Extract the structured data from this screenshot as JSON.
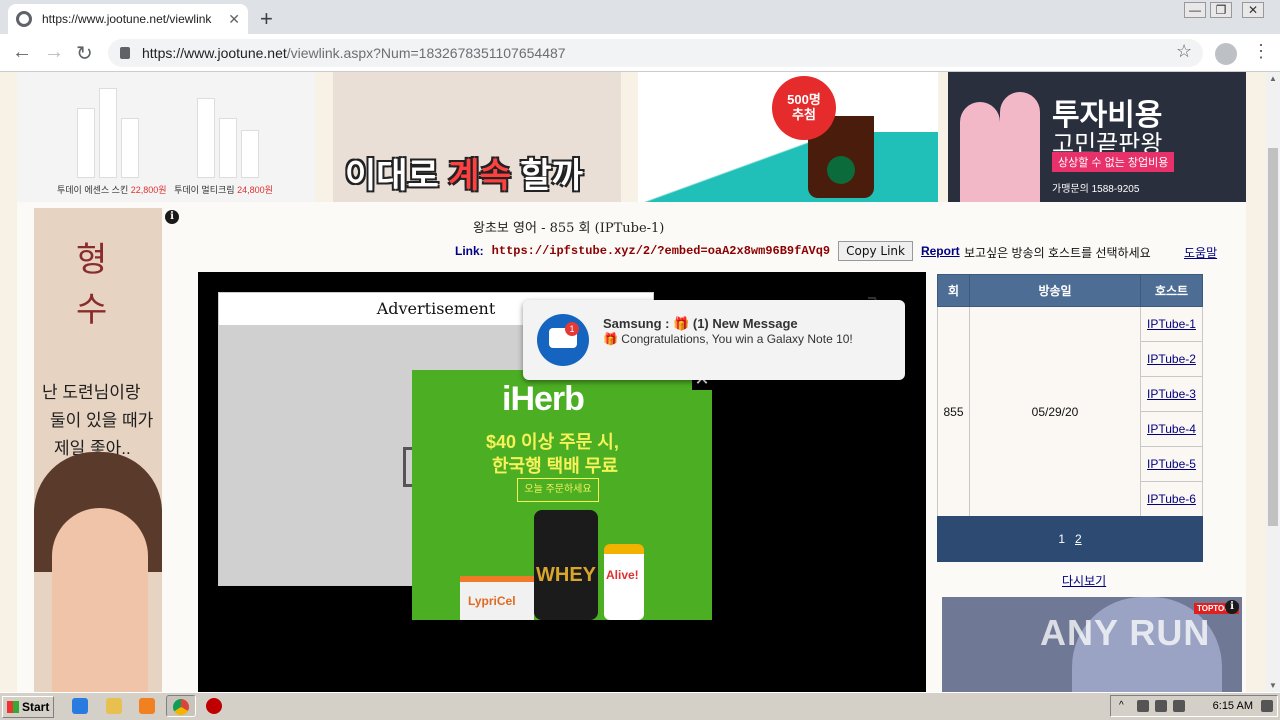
{
  "browser": {
    "tab_title": "https://www.jootune.net/viewlink.a",
    "tab_close": "✕",
    "new_tab": "+",
    "url_host": "https://www.jootune.net",
    "url_path": "/viewlink.aspx?Num=1832678351107654487",
    "back": "←",
    "forward": "→",
    "reload": "↻",
    "star": "☆",
    "menu": "⋮",
    "win_min": "—",
    "win_max": "❐",
    "win_close": "✕"
  },
  "banners": {
    "b1_caption_a": "투데이 에센스 스킨",
    "b1_price_a": "22,800원",
    "b1_caption_b": "투데이 멀티크림",
    "b1_price_b": "24,800원",
    "b2_text_a": "이대로 ",
    "b2_text_b": "계속",
    "b2_text_c": " 할까요?",
    "b3_badge_a": "500명",
    "b3_badge_b": "추첨",
    "b4_t1": "투자비용",
    "b4_t2": "고민끝판왕",
    "b4_t3": "상상할 수 없는 창업비용",
    "b4_t4": "가맹문의 1588-9205"
  },
  "sky_ad": {
    "big1": "형",
    "big2": "수",
    "line1": "난 도련님이랑",
    "line2": "둘이 있을 때가",
    "line3": "제일 좋아..",
    "info": "i"
  },
  "header": {
    "title": "왕초보 영어 - 855 회 (IPTube-1)",
    "link_label": "Link:",
    "link_url": "https://ipfstube.xyz/2/?embed=oaA2x8wm96B9fAVq9",
    "copy_label": "Copy Link",
    "report_label": "Report",
    "host_select": "보고싶은 방송의 호스트를 선택하세요",
    "help": "도움말"
  },
  "player": {
    "ad_heading": "Advertisement"
  },
  "iherb": {
    "logo": "iHerb",
    "line1": "$40 이상 주문 시,",
    "line2": "한국행 택배 무료",
    "cta": "오늘 주문하세요",
    "whey": "WHEY",
    "lypricel": "LypriCel",
    "alive": "Alive!",
    "close": "✕"
  },
  "notification": {
    "title": "Samsung : 🎁 (1) New Message",
    "body": "🎁 Congratulations, You win a Galaxy Note 10!",
    "badge": "1"
  },
  "episodes": {
    "headers": [
      "회",
      "방송일",
      "호스트"
    ],
    "episode": "855",
    "date": "05/29/20",
    "hosts": [
      "IPTube-1",
      "IPTube-2",
      "IPTube-3",
      "IPTube-4",
      "IPTube-5",
      "IPTube-6"
    ],
    "page1": "1",
    "page2": "2",
    "replay": "다시보기"
  },
  "right_ad": {
    "brand": "TOPTOON"
  },
  "watermark": "ANY  RUN",
  "taskbar": {
    "start": "Start",
    "clock": "6:15 AM"
  }
}
